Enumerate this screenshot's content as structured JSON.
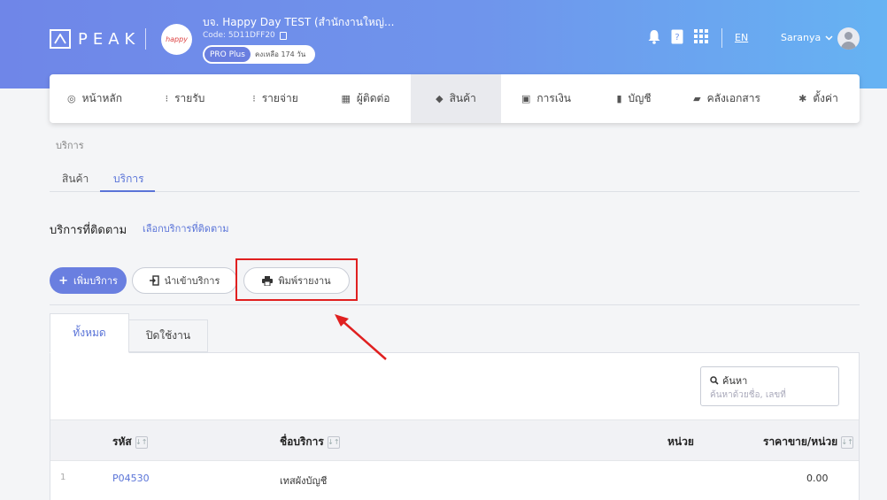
{
  "header": {
    "logo_text": "PEAK",
    "company_name": "บจ. Happy Day TEST (สำนักงานใหญ่...",
    "company_code": "Code: 5D11DFF20",
    "company_avatar_text": "happy",
    "plan": "PRO Plus",
    "days_left": "คงเหลือ 174 วัน",
    "lang": "EN",
    "user_name": "Saranya"
  },
  "menu": [
    {
      "label": "หน้าหลัก",
      "icon": "◎"
    },
    {
      "label": "รายรับ",
      "icon": "⁝"
    },
    {
      "label": "รายจ่าย",
      "icon": "⁝"
    },
    {
      "label": "ผู้ติดต่อ",
      "icon": "▦"
    },
    {
      "label": "สินค้า",
      "icon": "◆"
    },
    {
      "label": "การเงิน",
      "icon": "▣"
    },
    {
      "label": "บัญชี",
      "icon": "▮"
    },
    {
      "label": "คลังเอกสาร",
      "icon": "▰"
    },
    {
      "label": "ตั้งค่า",
      "icon": "✱"
    }
  ],
  "breadcrumb": "บริการ",
  "subtabs": {
    "products": "สินค้า",
    "services": "บริการ"
  },
  "section": {
    "title": "บริการที่ติดตาม",
    "link": "เลือกบริการที่ติดตาม"
  },
  "buttons": {
    "add": "เพิ่มบริการ",
    "import": "นำเข้าบริการ",
    "print": "พิมพ์รายงาน"
  },
  "tabs": {
    "all": "ทั้งหมด",
    "inactive": "ปิดใช้งาน"
  },
  "search": {
    "label": "ค้นหา",
    "placeholder": "ค้นหาด้วยชื่อ, เลขที่"
  },
  "table": {
    "columns": {
      "code": "รหัส",
      "name": "ชื่อบริการ",
      "unit": "หน่วย",
      "price": "ราคาขาย/หน่วย"
    },
    "rows": [
      {
        "no": "1",
        "code": "P04530",
        "name": "เทสผังบัญชี",
        "unit": "",
        "price": "0.00"
      }
    ]
  },
  "colors": {
    "accent": "#5a74d8",
    "highlight": "#e02020"
  }
}
